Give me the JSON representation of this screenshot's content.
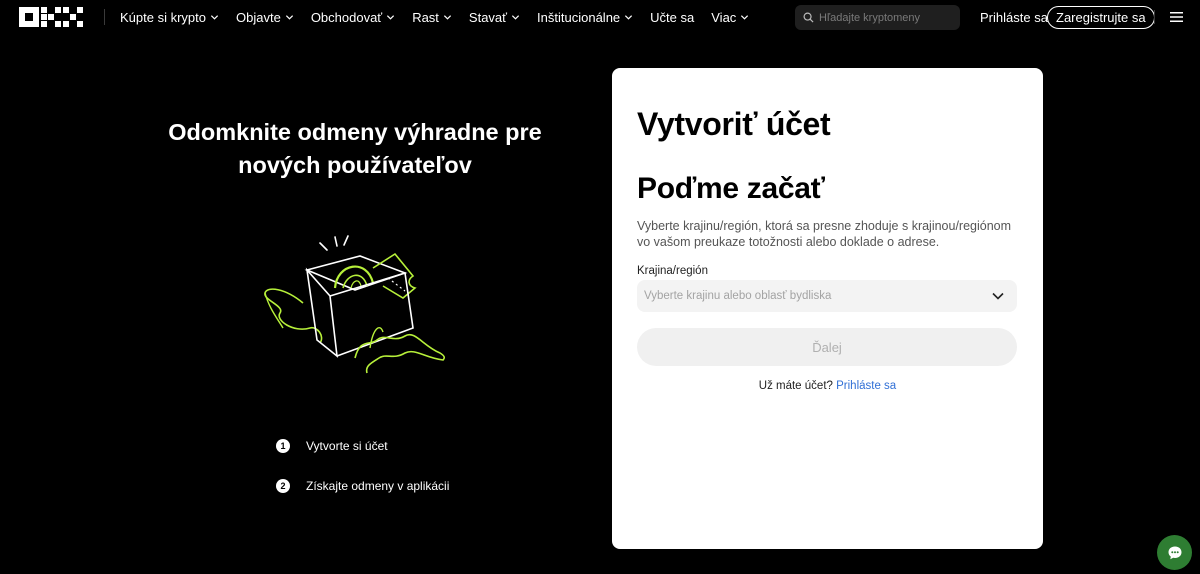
{
  "nav": {
    "menu": [
      {
        "label": "Kúpte si krypto",
        "has_dropdown": true
      },
      {
        "label": "Objavte",
        "has_dropdown": true
      },
      {
        "label": "Obchodovať",
        "has_dropdown": true
      },
      {
        "label": "Rast",
        "has_dropdown": true
      },
      {
        "label": "Stavať",
        "has_dropdown": true
      },
      {
        "label": "Inštitucionálne",
        "has_dropdown": true
      },
      {
        "label": "Učte sa",
        "has_dropdown": false
      },
      {
        "label": "Viac",
        "has_dropdown": true
      }
    ],
    "search_placeholder": "Hľadajte kryptomeny",
    "login_label": "Prihláste sa",
    "signup_label": "Zaregistrujte sa"
  },
  "hero": {
    "title_line1": "Odomknite odmeny výhradne pre",
    "title_line2": "nových používateľov",
    "steps": [
      {
        "num": "1",
        "label": "Vytvorte si účet"
      },
      {
        "num": "2",
        "label": "Získajte odmeny v aplikácii"
      }
    ]
  },
  "card": {
    "title": "Vytvoriť účet",
    "subtitle": "Poďme začať",
    "description": "Vyberte krajinu/región, ktorá sa presne zhoduje s krajinou/regiónom vo vašom preukaze totožnosti alebo doklade o adrese.",
    "country_label": "Krajina/región",
    "country_placeholder": "Vyberte krajinu alebo oblasť bydliska",
    "next_label": "Ďalej",
    "have_account_text": "Už máte účet?",
    "login_link": "Prihláste sa"
  },
  "colors": {
    "background": "#000000",
    "accent_lime": "#b7f03a",
    "link_blue": "#3170d6",
    "chat_green": "#2e7d32"
  }
}
